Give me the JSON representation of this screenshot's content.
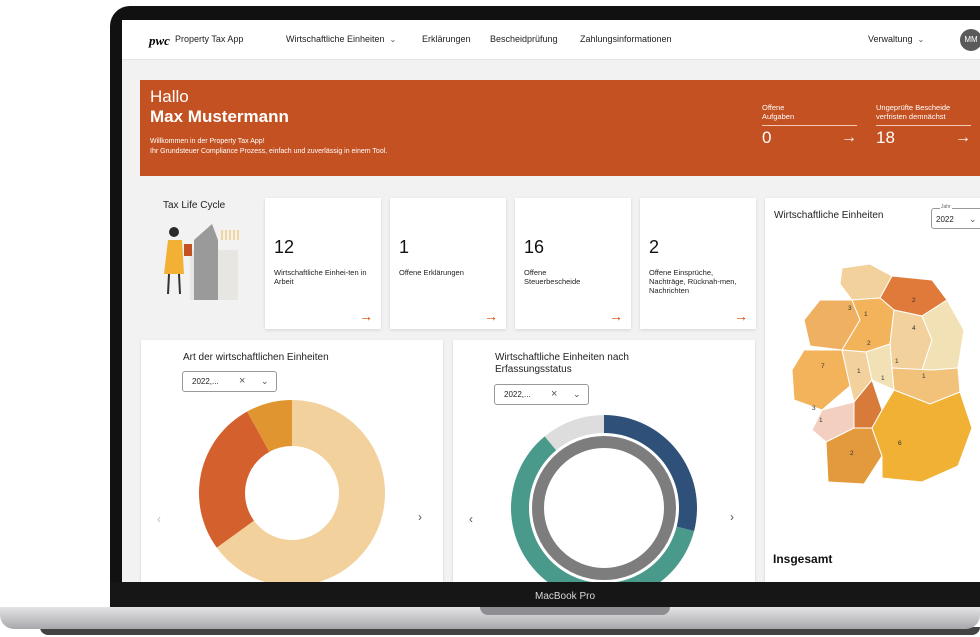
{
  "device": {
    "label": "MacBook Pro"
  },
  "nav": {
    "logo": "pwc",
    "app_name": "Property Tax App",
    "items": [
      {
        "label": "Wirtschaftliche Einheiten",
        "has_dropdown": true
      },
      {
        "label": "Erklärungen"
      },
      {
        "label": "Bescheidprüfung"
      },
      {
        "label": "Zahlungsinformationen"
      }
    ],
    "admin": "Verwaltung",
    "avatar": "MM"
  },
  "hero": {
    "greeting": "Hallo",
    "name": "Max Mustermann",
    "welcome_line1": "Willkommen in der Property Tax App!",
    "welcome_line2": "Ihr Grundsteuer Compliance Prozess, einfach und zuverlässig in einem Tool.",
    "kpis": [
      {
        "label_line1": "Offene",
        "label_line2": "Aufgaben",
        "value": "0"
      },
      {
        "label_line1": "Ungeprüfte Bescheide",
        "label_line2": "verfristen demnächst",
        "value": "18"
      }
    ],
    "color": "#c45121"
  },
  "lifecycle": {
    "title": "Tax Life Cycle",
    "cards": [
      {
        "value": "12",
        "label": "Wirtschaftliche Einhei-ten in Arbeit"
      },
      {
        "value": "1",
        "label": "Offene Erklärungen"
      },
      {
        "value": "16",
        "label": "Offene Steuerbescheide"
      },
      {
        "value": "2",
        "label": "Offene Einsprüche, Nachträge, Rücknah-men, Nachrichten"
      }
    ]
  },
  "panels": {
    "type_chart": {
      "title": "Art der wirtschaftlichen Einheiten",
      "filter": "2022,..."
    },
    "status_chart": {
      "title_line1": "Wirtschaftliche Einheiten nach",
      "title_line2": "Erfassungsstatus",
      "filter": "2022,..."
    },
    "map": {
      "title": "Wirtschaftliche Einheiten",
      "year_caption": "Jahr",
      "year": "2022",
      "total_label": "Insgesamt",
      "region_labels": [
        "3",
        "1",
        "2",
        "4",
        "2",
        "1",
        "7",
        "1",
        "1",
        "1",
        "3",
        "1",
        "2",
        "6"
      ]
    }
  },
  "chart_data": [
    {
      "type": "pie",
      "title": "Art der wirtschaftlichen Einheiten",
      "slices": [
        {
          "value": 65,
          "color": "#f2d19c"
        },
        {
          "value": 27,
          "color": "#d4602e"
        },
        {
          "value": 8,
          "color": "#e09530"
        }
      ]
    },
    {
      "type": "pie",
      "title": "Wirtschaftliche Einheiten nach Erfassungsstatus",
      "outer_ring": [
        {
          "value": 29,
          "color": "#2f5179"
        },
        {
          "value": 60,
          "color": "#4a9a8c"
        },
        {
          "value": 11,
          "color": "#dddddd"
        }
      ],
      "inner_ring": [
        {
          "value": 100,
          "color": "#7d7d7d"
        }
      ]
    }
  ]
}
